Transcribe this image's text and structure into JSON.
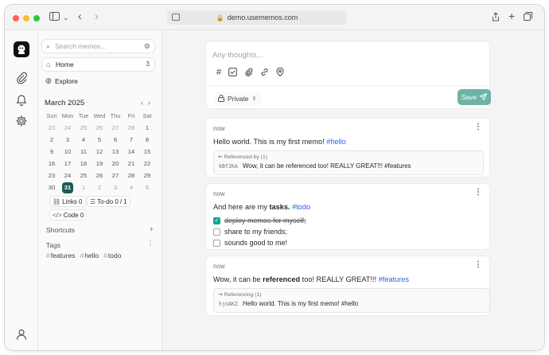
{
  "browser": {
    "url": "demo.usememos.com",
    "colors": {
      "close": "#ff5f57",
      "minimize": "#febc2e",
      "maximize": "#28c840"
    }
  },
  "rail": {
    "icons": [
      "logo-icon",
      "paperclip-icon",
      "bell-icon",
      "gear-icon",
      "user-icon"
    ]
  },
  "sidebar": {
    "search_placeholder": "Search memos...",
    "nav": [
      {
        "label": "Home",
        "count": "3"
      },
      {
        "label": "Explore"
      }
    ],
    "calendar": {
      "month": "March 2025",
      "weekdays": [
        "Sun",
        "Mon",
        "Tue",
        "Wed",
        "Thu",
        "Fri",
        "Sat"
      ],
      "weeks": [
        [
          "23",
          "24",
          "25",
          "26",
          "27",
          "28",
          "1"
        ],
        [
          "2",
          "3",
          "4",
          "5",
          "6",
          "7",
          "8"
        ],
        [
          "9",
          "10",
          "11",
          "12",
          "13",
          "14",
          "15"
        ],
        [
          "16",
          "17",
          "18",
          "19",
          "20",
          "21",
          "22"
        ],
        [
          "23",
          "24",
          "25",
          "26",
          "27",
          "28",
          "29"
        ],
        [
          "30",
          "31",
          "1",
          "2",
          "3",
          "4",
          "5"
        ]
      ],
      "today": "31"
    },
    "stats": {
      "links": "Links 0",
      "todo": "To-do 0",
      "todo_total": "1",
      "code": "Code 0"
    },
    "shortcuts_label": "Shortcuts",
    "tags_label": "Tags",
    "tags": [
      "features",
      "hello",
      "todo"
    ]
  },
  "editor": {
    "placeholder": "Any thoughts...",
    "tools": [
      "hash-icon",
      "checkbox-icon",
      "paperclip-icon",
      "link-icon",
      "location-icon"
    ],
    "visibility": "Private",
    "save_label": "Save",
    "accent": "#6fb3a6"
  },
  "memos": [
    {
      "time": "now",
      "text_before": "Hello world. This is my first memo! ",
      "tag": "#hello",
      "reference": {
        "label": "Referenced by (1)",
        "id": "kBfJKA",
        "text": "Wow, it can be referenced too! REALLY GREAT!!! #features"
      }
    },
    {
      "time": "now",
      "text_before": "And here are my ",
      "bold": "tasks.",
      "tag": "#todo",
      "tasks": [
        {
          "text": "deploy memos for myself;",
          "done": true
        },
        {
          "text": "share to my friends;",
          "done": false
        },
        {
          "text": "sounds good to me!",
          "done": false
        }
      ]
    },
    {
      "time": "now",
      "text_before": "Wow, it can be ",
      "bold": "referenced",
      "text_after": " too! REALLY GREAT!!! ",
      "tag": "#features",
      "reference": {
        "label": "Referencing (1)",
        "id": "hjnAKZ",
        "text": "Hello world. This is my first memo! #hello"
      }
    }
  ]
}
